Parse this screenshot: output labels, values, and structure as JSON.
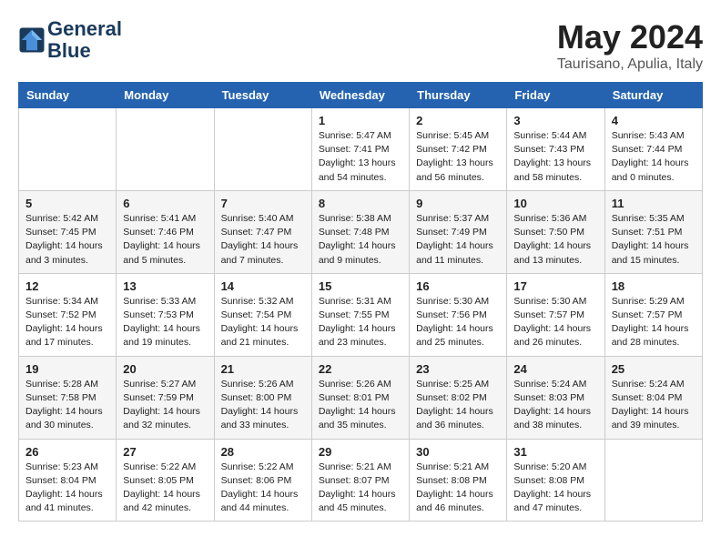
{
  "logo": {
    "line1": "General",
    "line2": "Blue"
  },
  "title": "May 2024",
  "location": "Taurisano, Apulia, Italy",
  "days_header": [
    "Sunday",
    "Monday",
    "Tuesday",
    "Wednesday",
    "Thursday",
    "Friday",
    "Saturday"
  ],
  "weeks": [
    [
      {
        "day": "",
        "info": ""
      },
      {
        "day": "",
        "info": ""
      },
      {
        "day": "",
        "info": ""
      },
      {
        "day": "1",
        "info": "Sunrise: 5:47 AM\nSunset: 7:41 PM\nDaylight: 13 hours\nand 54 minutes."
      },
      {
        "day": "2",
        "info": "Sunrise: 5:45 AM\nSunset: 7:42 PM\nDaylight: 13 hours\nand 56 minutes."
      },
      {
        "day": "3",
        "info": "Sunrise: 5:44 AM\nSunset: 7:43 PM\nDaylight: 13 hours\nand 58 minutes."
      },
      {
        "day": "4",
        "info": "Sunrise: 5:43 AM\nSunset: 7:44 PM\nDaylight: 14 hours\nand 0 minutes."
      }
    ],
    [
      {
        "day": "5",
        "info": "Sunrise: 5:42 AM\nSunset: 7:45 PM\nDaylight: 14 hours\nand 3 minutes."
      },
      {
        "day": "6",
        "info": "Sunrise: 5:41 AM\nSunset: 7:46 PM\nDaylight: 14 hours\nand 5 minutes."
      },
      {
        "day": "7",
        "info": "Sunrise: 5:40 AM\nSunset: 7:47 PM\nDaylight: 14 hours\nand 7 minutes."
      },
      {
        "day": "8",
        "info": "Sunrise: 5:38 AM\nSunset: 7:48 PM\nDaylight: 14 hours\nand 9 minutes."
      },
      {
        "day": "9",
        "info": "Sunrise: 5:37 AM\nSunset: 7:49 PM\nDaylight: 14 hours\nand 11 minutes."
      },
      {
        "day": "10",
        "info": "Sunrise: 5:36 AM\nSunset: 7:50 PM\nDaylight: 14 hours\nand 13 minutes."
      },
      {
        "day": "11",
        "info": "Sunrise: 5:35 AM\nSunset: 7:51 PM\nDaylight: 14 hours\nand 15 minutes."
      }
    ],
    [
      {
        "day": "12",
        "info": "Sunrise: 5:34 AM\nSunset: 7:52 PM\nDaylight: 14 hours\nand 17 minutes."
      },
      {
        "day": "13",
        "info": "Sunrise: 5:33 AM\nSunset: 7:53 PM\nDaylight: 14 hours\nand 19 minutes."
      },
      {
        "day": "14",
        "info": "Sunrise: 5:32 AM\nSunset: 7:54 PM\nDaylight: 14 hours\nand 21 minutes."
      },
      {
        "day": "15",
        "info": "Sunrise: 5:31 AM\nSunset: 7:55 PM\nDaylight: 14 hours\nand 23 minutes."
      },
      {
        "day": "16",
        "info": "Sunrise: 5:30 AM\nSunset: 7:56 PM\nDaylight: 14 hours\nand 25 minutes."
      },
      {
        "day": "17",
        "info": "Sunrise: 5:30 AM\nSunset: 7:57 PM\nDaylight: 14 hours\nand 26 minutes."
      },
      {
        "day": "18",
        "info": "Sunrise: 5:29 AM\nSunset: 7:57 PM\nDaylight: 14 hours\nand 28 minutes."
      }
    ],
    [
      {
        "day": "19",
        "info": "Sunrise: 5:28 AM\nSunset: 7:58 PM\nDaylight: 14 hours\nand 30 minutes."
      },
      {
        "day": "20",
        "info": "Sunrise: 5:27 AM\nSunset: 7:59 PM\nDaylight: 14 hours\nand 32 minutes."
      },
      {
        "day": "21",
        "info": "Sunrise: 5:26 AM\nSunset: 8:00 PM\nDaylight: 14 hours\nand 33 minutes."
      },
      {
        "day": "22",
        "info": "Sunrise: 5:26 AM\nSunset: 8:01 PM\nDaylight: 14 hours\nand 35 minutes."
      },
      {
        "day": "23",
        "info": "Sunrise: 5:25 AM\nSunset: 8:02 PM\nDaylight: 14 hours\nand 36 minutes."
      },
      {
        "day": "24",
        "info": "Sunrise: 5:24 AM\nSunset: 8:03 PM\nDaylight: 14 hours\nand 38 minutes."
      },
      {
        "day": "25",
        "info": "Sunrise: 5:24 AM\nSunset: 8:04 PM\nDaylight: 14 hours\nand 39 minutes."
      }
    ],
    [
      {
        "day": "26",
        "info": "Sunrise: 5:23 AM\nSunset: 8:04 PM\nDaylight: 14 hours\nand 41 minutes."
      },
      {
        "day": "27",
        "info": "Sunrise: 5:22 AM\nSunset: 8:05 PM\nDaylight: 14 hours\nand 42 minutes."
      },
      {
        "day": "28",
        "info": "Sunrise: 5:22 AM\nSunset: 8:06 PM\nDaylight: 14 hours\nand 44 minutes."
      },
      {
        "day": "29",
        "info": "Sunrise: 5:21 AM\nSunset: 8:07 PM\nDaylight: 14 hours\nand 45 minutes."
      },
      {
        "day": "30",
        "info": "Sunrise: 5:21 AM\nSunset: 8:08 PM\nDaylight: 14 hours\nand 46 minutes."
      },
      {
        "day": "31",
        "info": "Sunrise: 5:20 AM\nSunset: 8:08 PM\nDaylight: 14 hours\nand 47 minutes."
      },
      {
        "day": "",
        "info": ""
      }
    ]
  ]
}
